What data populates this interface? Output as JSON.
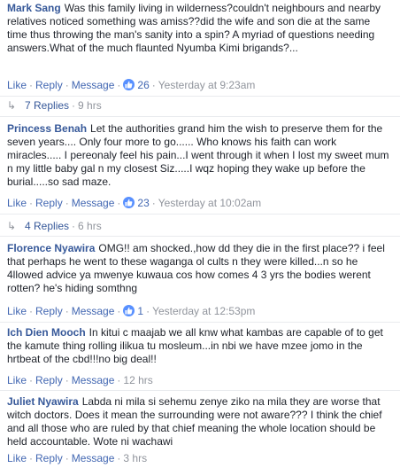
{
  "comments": [
    {
      "author": "Mark Sang",
      "text": "Was this family living in wilderness?couldn't neighbours and nearby relatives noticed something was amiss??did the wife and son die at the same time thus throwing the man's sanity into a spin? A myriad of questions needing answers.What of the much flaunted Nyumba Kimi brigands?...",
      "like_label": "Like",
      "reply_label": "Reply",
      "message_label": "Message",
      "likes": "26",
      "time": "Yesterday at 9:23am",
      "replies_label": "7 Replies",
      "replies_time": "9 hrs"
    },
    {
      "author": "Princess Benah",
      "text": "Let the authorities grand him the wish to preserve them for the seven years.... Only four more to go...... Who knows his faith can work miracles..... I pereonaly feel his pain...I went through it when I lost my sweet mum n my little baby gal n my closest Siz.....I wqz hoping they wake up before the burial.....so sad maze.",
      "like_label": "Like",
      "reply_label": "Reply",
      "message_label": "Message",
      "likes": "23",
      "time": "Yesterday at 10:02am",
      "replies_label": "4 Replies",
      "replies_time": "6 hrs"
    },
    {
      "author": "Florence Nyawira",
      "text": "OMG!! am shocked.,how dd they die in the first place?? i feel that perhaps he went to these waganga ol cults n they were killed...n so he 4llowed advice ya mwenye kuwaua cos how comes 4 3 yrs the bodies werent rotten? he's hiding somthng",
      "like_label": "Like",
      "reply_label": "Reply",
      "message_label": "Message",
      "likes": "1",
      "time": "Yesterday at 12:53pm"
    },
    {
      "author": "Ich Dien Mooch",
      "text": "In kitui c maajab we all knw what kambas are capable of to get the kamute thing rolling ilikua tu mosleum...in nbi we have mzee jomo in the hrtbeat of the cbd!!!no big deal!!",
      "like_label": "Like",
      "reply_label": "Reply",
      "message_label": "Message",
      "time": "12 hrs"
    },
    {
      "author": "Juliet Nyawira",
      "text": "Labda ni mila si sehemu zenye ziko na mila they are worse that witch doctors. Does it mean the surrounding were not aware??? I think the chief and all those who are ruled by that chief meaning the whole location should be held accountable. Wote ni wachawi",
      "like_label": "Like",
      "reply_label": "Reply",
      "message_label": "Message",
      "time": "3 hrs"
    }
  ],
  "dot": "·",
  "reply_arrow": "↳",
  "colors": {
    "link": "#4267b2",
    "author": "#365899",
    "meta": "#90949c",
    "like_badge": "#5890ff",
    "divider": "#e9ebee"
  }
}
